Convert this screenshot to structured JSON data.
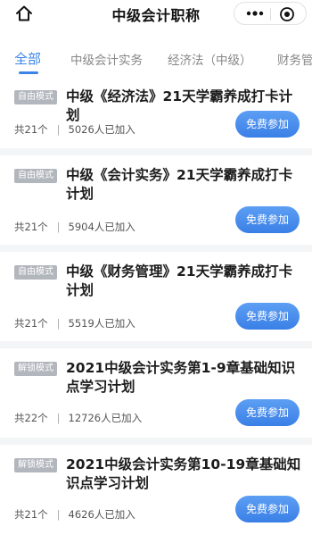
{
  "header": {
    "title": "中级会计职称",
    "home_icon": "home-icon",
    "more_icon": "more-dots-icon",
    "close_icon": "target-close-icon"
  },
  "tabs": [
    {
      "label": "全部",
      "active": true
    },
    {
      "label": "中级会计实务",
      "active": false
    },
    {
      "label": "经济法（中级）",
      "active": false
    },
    {
      "label": "财务管",
      "active": false
    }
  ],
  "colors": {
    "accent": "#3a84e8",
    "badge": "#b2b6bd"
  },
  "plans": [
    {
      "badge": "自由模式",
      "title": "中级《经济法》21天学霸养成打卡计划",
      "count": "共21个",
      "joined": "5026人已加入",
      "button": "免费参加"
    },
    {
      "badge": "自由模式",
      "title": "中级《会计实务》21天学霸养成打卡计划",
      "count": "共21个",
      "joined": "5904人已加入",
      "button": "免费参加"
    },
    {
      "badge": "自由模式",
      "title": "中级《财务管理》21天学霸养成打卡计划",
      "count": "共21个",
      "joined": "5519人已加入",
      "button": "免费参加"
    },
    {
      "badge": "解锁模式",
      "title": "2021中级会计实务第1-9章基础知识点学习计划",
      "count": "共22个",
      "joined": "12726人已加入",
      "button": "免费参加"
    },
    {
      "badge": "解锁模式",
      "title": "2021中级会计实务第10-19章基础知识点学习计划",
      "count": "共21个",
      "joined": "4626人已加入",
      "button": "免费参加"
    }
  ]
}
